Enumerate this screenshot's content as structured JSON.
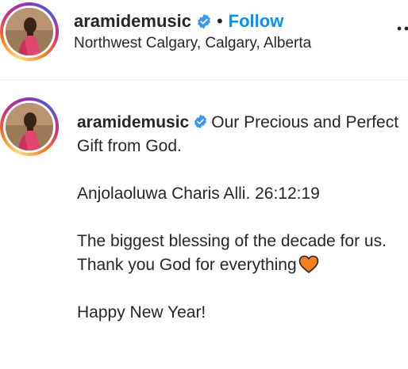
{
  "post_header": {
    "username": "aramidemusic",
    "separator": "•",
    "follow_label": "Follow",
    "location": "Northwest Calgary, Calgary, Alberta",
    "verified_icon": "verified-badge-icon",
    "more_icon": "more-options-icon"
  },
  "caption": {
    "username": "aramidemusic",
    "lines": [
      "Our Precious and Perfect Gift from God.",
      "Anjolaoluwa Charis Alli. 26:12:19",
      "The biggest blessing of the decade for us.",
      "Thank you God for everything",
      "Happy New Year!"
    ],
    "heart_icon": "orange-heart-emoji",
    "heart_color": "#f4811f"
  },
  "colors": {
    "follow": "#0095f6",
    "verified": "#3897f0",
    "text": "#262626",
    "divider": "#efefef"
  }
}
